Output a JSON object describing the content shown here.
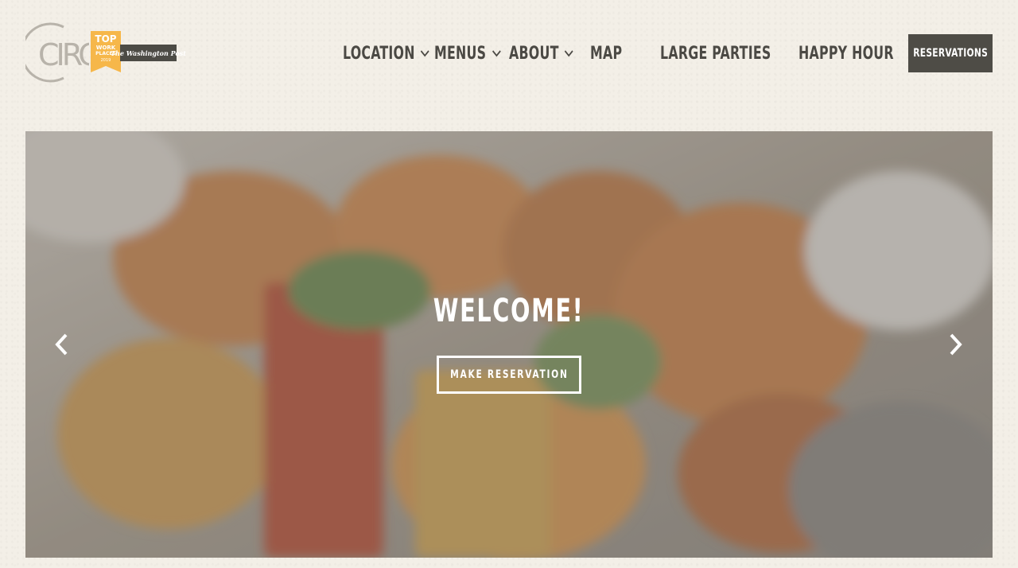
{
  "header": {
    "logo_text": "CIRCA",
    "badge": {
      "line1": "TOP",
      "line2": "WORK",
      "line3": "PLACES",
      "line4": "2019"
    },
    "publication": "The Washington Post"
  },
  "nav": {
    "items": [
      {
        "label": "LOCATION",
        "dropdown": true
      },
      {
        "label": "MENUS",
        "dropdown": true
      },
      {
        "label": "ABOUT",
        "dropdown": true
      },
      {
        "label": "MAP",
        "dropdown": false
      },
      {
        "label": "LARGE PARTIES",
        "dropdown": false
      },
      {
        "label": "HAPPY HOUR",
        "dropdown": false
      }
    ],
    "reservations_label": "RESERVATIONS"
  },
  "hero": {
    "title": "WELCOME!",
    "cta_label": "MAKE RESERVATION"
  },
  "colors": {
    "background": "#f3efe7",
    "text": "#4b4944",
    "button": "#4e4c46",
    "badge": "#f6b74a"
  }
}
